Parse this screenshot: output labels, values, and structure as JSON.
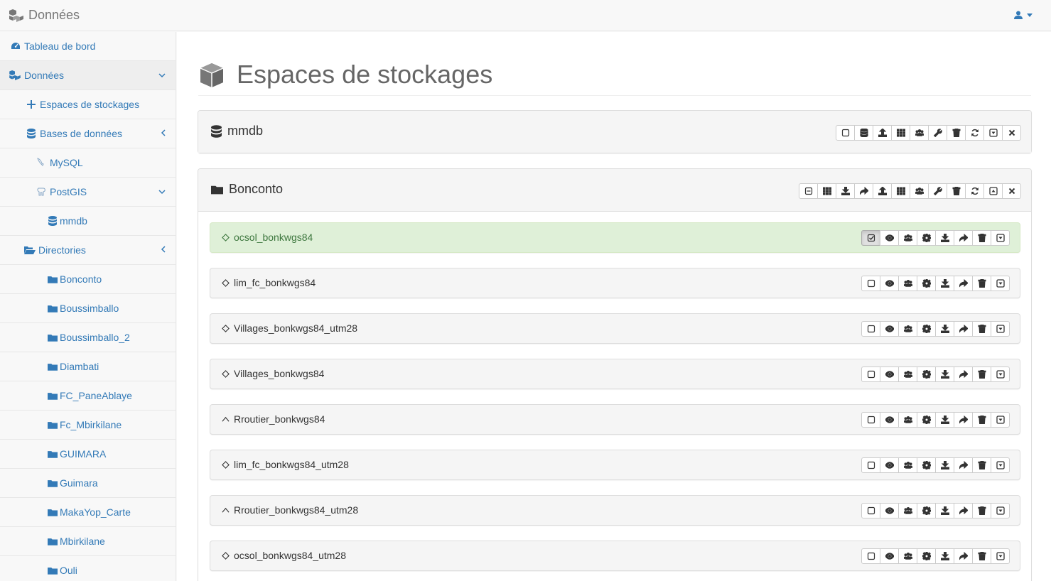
{
  "navbar": {
    "brand": "Données"
  },
  "sidebar": {
    "items": [
      {
        "label": "Tableau de bord",
        "icon": "dashboard-icon"
      },
      {
        "label": "Données",
        "icon": "cubes-icon"
      },
      {
        "label": "Espaces de stockages",
        "icon": "plus-icon"
      },
      {
        "label": "Bases de données",
        "icon": "database-icon"
      },
      {
        "label": "MySQL",
        "icon": "dolphin-icon"
      },
      {
        "label": "PostGIS",
        "icon": "elephant-icon"
      },
      {
        "label": "mmdb",
        "icon": "database-icon"
      },
      {
        "label": "Directories",
        "icon": "folder-open-icon"
      },
      {
        "label": "Bonconto",
        "icon": "folder-icon"
      },
      {
        "label": "Boussimballo",
        "icon": "folder-icon"
      },
      {
        "label": "Boussimballo_2",
        "icon": "folder-icon"
      },
      {
        "label": "Diambati",
        "icon": "folder-icon"
      },
      {
        "label": "FC_PaneAblaye",
        "icon": "folder-icon"
      },
      {
        "label": "Fc_Mbirkilane",
        "icon": "folder-icon"
      },
      {
        "label": "GUIMARA",
        "icon": "folder-icon"
      },
      {
        "label": "Guimara",
        "icon": "folder-icon"
      },
      {
        "label": "MakaYop_Carte",
        "icon": "folder-icon"
      },
      {
        "label": "Mbirkilane",
        "icon": "folder-icon"
      },
      {
        "label": "Ouli",
        "icon": "folder-icon"
      }
    ]
  },
  "main": {
    "title": "Espaces de stockages",
    "panels": [
      {
        "title": "mmdb",
        "icon": "database-icon"
      },
      {
        "title": "Bonconto",
        "icon": "folder-icon"
      }
    ],
    "layers": [
      {
        "name": "ocsol_bonkwgs84",
        "geom": "polygon-icon",
        "selected": true
      },
      {
        "name": "lim_fc_bonkwgs84",
        "geom": "polygon-icon",
        "selected": false
      },
      {
        "name": "Villages_bonkwgs84_utm28",
        "geom": "polygon-icon",
        "selected": false
      },
      {
        "name": "Villages_bonkwgs84",
        "geom": "polygon-icon",
        "selected": false
      },
      {
        "name": "Rroutier_bonkwgs84",
        "geom": "line-icon",
        "selected": false
      },
      {
        "name": "lim_fc_bonkwgs84_utm28",
        "geom": "polygon-icon",
        "selected": false
      },
      {
        "name": "Rroutier_bonkwgs84_utm28",
        "geom": "line-icon",
        "selected": false
      },
      {
        "name": "ocsol_bonkwgs84_utm28",
        "geom": "polygon-icon",
        "selected": false
      }
    ]
  },
  "colors": {
    "link": "#337ab7",
    "selected_bg": "#dff0d8",
    "selected_text": "#3c763d"
  }
}
